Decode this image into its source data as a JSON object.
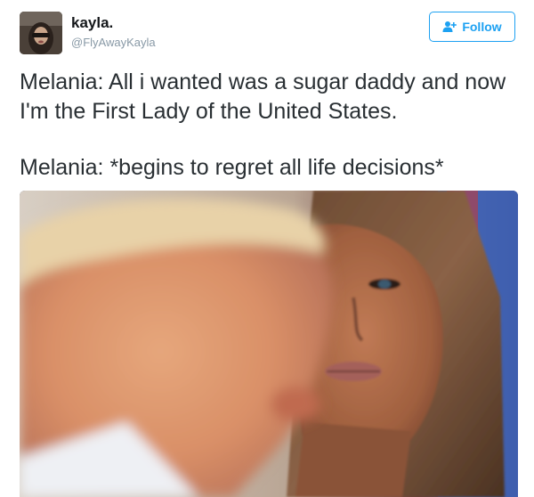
{
  "user": {
    "display_name": "kayla.",
    "handle": "@FlyAwayKayla"
  },
  "follow_button": {
    "label": "Follow",
    "icon": "add-user-icon",
    "color": "#1da1f2"
  },
  "tweet": {
    "lines": [
      "Melania: All i wanted was a sugar daddy and now I'm the First Lady of the United States.",
      "Melania: *begins to regret all life decisions*"
    ]
  },
  "colors": {
    "text": "#292f33",
    "handle": "#8899a6",
    "accent": "#1da1f2"
  }
}
